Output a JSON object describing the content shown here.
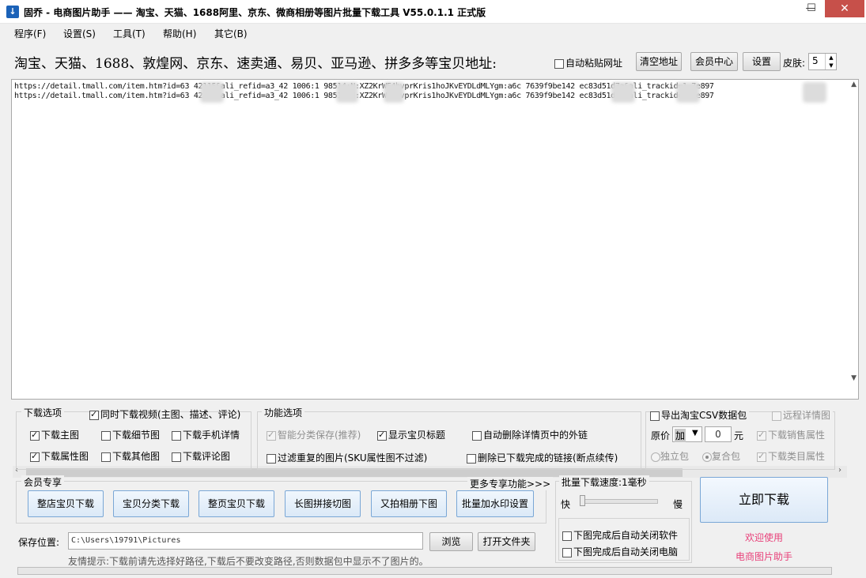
{
  "window": {
    "title": "固乔 - 电商图片助手 —— 淘宝、天猫、1688阿里、京东、微商相册等图片批量下载工具 V55.0.1.1 正式版",
    "minimize": "—",
    "maximize": "☐",
    "close": "✕"
  },
  "menu": [
    "程序(F)",
    "设置(S)",
    "工具(T)",
    "帮助(H)",
    "其它(B)"
  ],
  "header": {
    "label": "淘宝、天猫、1688、敦煌网、京东、速卖通、易贝、亚马逊、拼多多等宝贝地址:",
    "auto_paste": "自动粘贴网址",
    "clear_button": "清空地址",
    "member_button": "会员中心",
    "settings_button": "设置",
    "skin_label": "皮肤:",
    "skin_value": "5"
  },
  "urls": [
    "https://detail.tmall.com/item.htm?id=63    42115&ali_refid=a3_42    1006:1   98514:N:XZ2KrWF4hvprKris1hoJKvEYDLdMLYgm:a6c    7639f9be142    ec83d51d7a&ali_trackid=1    7e897",
    "https://detail.tmall.com/item.htm?id=63    42115&ali_refid=a3_42    1006:1   98514:N:XZ2KrWF4hvprKris1hoJKvEYDLdMLYgm:a6c    7639f9be142    ec83d51d7a&ali_trackid=1    7e897"
  ],
  "download_options": {
    "title": "下载选项",
    "video": "同时下载视频(主图、描述、评论)",
    "main_image": "下载主图",
    "detail_image": "下载细节图",
    "mobile_detail": "下载手机详情",
    "attr_image": "下载属性图",
    "other_image": "下载其他图",
    "review_image": "下载评论图"
  },
  "function_options": {
    "title": "功能选项",
    "smart_category": "智能分类保存(推荐)",
    "show_title": "显示宝贝标题",
    "auto_delete_links": "自动删除详情页中的外链",
    "filter_duplicates": "过滤重复的图片(SKU属性图不过滤)",
    "delete_finished": "删除已下载完成的链接(断点续传)"
  },
  "csv": {
    "export": "导出淘宝CSV数据包",
    "remote_detail": "远程详情图",
    "price_label": "原价",
    "price_op": "加",
    "price_value": "0",
    "unit": "元",
    "sales_attr": "下载销售属性",
    "single_pack": "独立包",
    "combo_pack": "复合包",
    "category_attr": "下载类目属性"
  },
  "member": {
    "title": "会员专享",
    "more": "更多专享功能>>>",
    "buttons": [
      "整店宝贝下载",
      "宝贝分类下载",
      "整页宝贝下载",
      "长图拼接切图",
      "又拍相册下图",
      "批量加水印设置"
    ]
  },
  "speed": {
    "title": "批量下载速度:1毫秒",
    "fast": "快",
    "slow": "慢",
    "level": 0,
    "close_app": "下图完成后自动关闭软件",
    "shutdown": "下图完成后自动关闭电脑"
  },
  "save": {
    "label": "保存位置:",
    "path": "C:\\Users\\19791\\Pictures",
    "browse": "浏览",
    "open_folder": "打开文件夹",
    "tip": "友情提示:下载前请先选择好路径,下载后不要改变路径,否则数据包中显示不了图片的。"
  },
  "start_button": "立即下载",
  "welcome": [
    "欢迎使用",
    "电商图片助手"
  ]
}
